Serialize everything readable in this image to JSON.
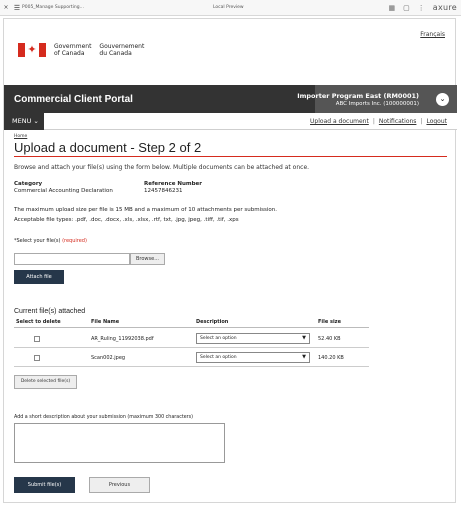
{
  "browser": {
    "page_name": "P005_Manage Supporting...",
    "preview_label": "Local Preview",
    "brand": "axure"
  },
  "header": {
    "language_link": "Français",
    "gov_name_en": "Government\nof Canada",
    "gov_name_fr": "Gouvernement\ndu Canada"
  },
  "banner": {
    "portal_title": "Commercial Client Portal",
    "importer_name": "Importer Program East (RM0001)",
    "importer_sub": "ABC Imports Inc. (100000001)"
  },
  "nav": {
    "menu_label": "MENU",
    "links": [
      "Upload a document",
      "Notifications",
      "Logout"
    ]
  },
  "breadcrumb": "Home",
  "page_title": "Upload a document - Step 2 of 2",
  "intro": "Browse and attach your file(s) using the form below. Multiple documents can be attached at once.",
  "details": {
    "category_label": "Category",
    "category_value": "Commercial Accounting Declaration",
    "reference_label": "Reference Number",
    "reference_value": "12457846231"
  },
  "limits": {
    "max_size": "The maximum upload size per file is 15 MB and a maximum of 10 attachments per submission.",
    "accepted": "Acceptable file types: .pdf, .doc, .docx, .xls, .xlsx, .rtf, txt, .jpg, jpeg, .tiff, .tif, .xps"
  },
  "upload": {
    "select_label": "*Select your file(s)",
    "required": "(required)",
    "browse_label": "Browse...",
    "attach_label": "Attach file"
  },
  "attached": {
    "title": "Current file(s) attached",
    "columns": [
      "Select to delete",
      "File Name",
      "Description",
      "File size"
    ],
    "rows": [
      {
        "file_name": "AR_Ruling_11992038.pdf",
        "description": "Select an option",
        "size": "52.40 KB"
      },
      {
        "file_name": "Scan002.jpeg",
        "description": "Select an option",
        "size": "140.20 KB"
      }
    ],
    "delete_label": "Delete selected file(s)"
  },
  "description": {
    "label": "Add a short description about your submission (maximum 300 characters)",
    "value": ""
  },
  "actions": {
    "submit_label": "Submit file(s)",
    "previous_label": "Previous"
  },
  "colors": {
    "banner": "#333333",
    "primary_button": "#26374a",
    "accent_red": "#d52b1e"
  }
}
